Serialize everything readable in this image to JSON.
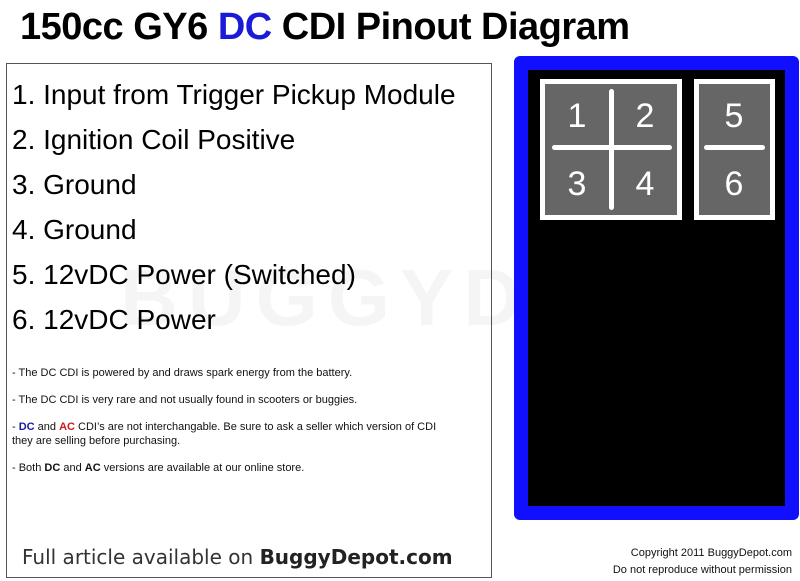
{
  "title": {
    "part1": "150cc GY6 ",
    "dc": "DC",
    "part2": " CDI Pinout Diagram"
  },
  "pins": [
    {
      "number": "1",
      "label": "1. Input from Trigger Pickup Module"
    },
    {
      "number": "2",
      "label": "2. Ignition Coil Positive"
    },
    {
      "number": "3",
      "label": "3. Ground"
    },
    {
      "number": "4",
      "label": "4. Ground"
    },
    {
      "number": "5",
      "label": "5. 12vDC Power (Switched)"
    },
    {
      "number": "6",
      "label": "6. 12vDC Power"
    }
  ],
  "notes": {
    "n1": "- The DC CDI is powered by and draws spark energy from the battery.",
    "n2": "- The DC CDI is very rare and not usually found in scooters or buggies.",
    "n3_prefix": "- ",
    "n3_dc": "DC",
    "n3_and": " and ",
    "n3_ac": "AC",
    "n3_rest": " CDI’s are not interchangable. Be sure to ask a seller which version of CDI they are selling before purchasing.",
    "n4_prefix": "- Both ",
    "n4_dc": "DC",
    "n4_and": " and ",
    "n4_ac": "AC",
    "n4_rest": " versions are available at our online store."
  },
  "article": {
    "prefix": "Full article available on ",
    "site": "BuggyDepot.com"
  },
  "watermark": "BUGGYDEPOT",
  "copyright": {
    "line1": "Copyright 2011 BuggyDepot.com",
    "line2": "Do not reproduce without permission"
  },
  "colors": {
    "dc_blue": "#1a1ad8",
    "ac_red": "#d01818",
    "connector_border": "#1010ff",
    "pin_gray": "#666666"
  }
}
